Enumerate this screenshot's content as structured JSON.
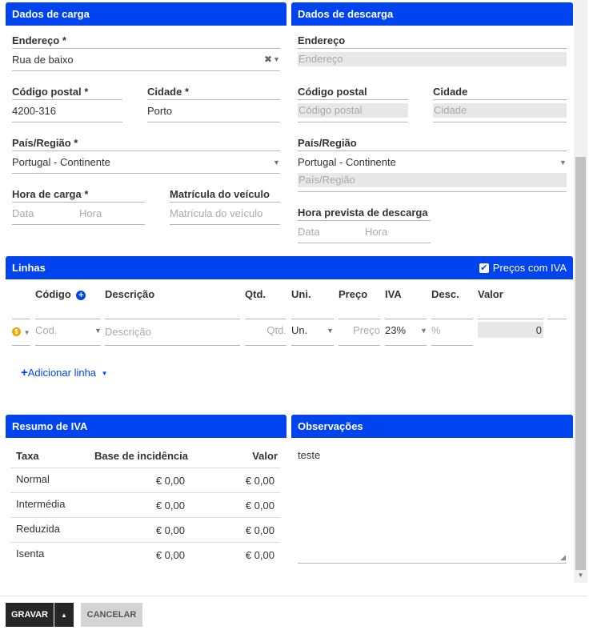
{
  "loading": {
    "title": "Dados de carga",
    "address_label": "Endereço *",
    "address_value": "Rua de baixo",
    "postal_label": "Código postal *",
    "postal_value": "4200-316",
    "city_label": "Cidade *",
    "city_value": "Porto",
    "country_label": "País/Região *",
    "country_value": "Portugal - Continente",
    "time_label": "Hora de carga *",
    "date_placeholder": "Data",
    "hour_placeholder": "Hora",
    "plate_label": "Matrícula do veículo",
    "plate_placeholder": "Matrícula do veículo"
  },
  "unloading": {
    "title": "Dados de descarga",
    "address_label": "Endereço",
    "address_placeholder": "Endereço",
    "postal_label": "Código postal",
    "postal_placeholder": "Código postal",
    "city_label": "Cidade",
    "city_placeholder": "Cidade",
    "country_label": "País/Região",
    "country_value": "Portugal - Continente",
    "country_placeholder": "País/Região",
    "time_label": "Hora prevista de descarga",
    "date_placeholder": "Data",
    "hour_placeholder": "Hora"
  },
  "lines": {
    "title": "Linhas",
    "prices_with_vat_label": "Preços com IVA",
    "prices_with_vat_checked": true,
    "columns": {
      "code": "Código",
      "description": "Descrição",
      "qty": "Qtd.",
      "unit": "Uni.",
      "price": "Preço",
      "vat": "IVA",
      "discount": "Desc.",
      "value": "Valor"
    },
    "row": {
      "code_placeholder": "Cod.",
      "description_placeholder": "Descrição",
      "qty_placeholder": "Qtd.",
      "unit_value": "Un.",
      "price_placeholder": "Preço",
      "vat_value": "23%",
      "discount_placeholder": "%",
      "value": "0"
    },
    "add_line_label": "Adicionar linha"
  },
  "vat_summary": {
    "title": "Resumo de IVA",
    "headers": [
      "Taxa",
      "Base de incidência",
      "Valor"
    ],
    "rows": [
      {
        "rate": "Normal",
        "base": "€ 0,00",
        "value": "€ 0,00"
      },
      {
        "rate": "Intermédia",
        "base": "€ 0,00",
        "value": "€ 0,00"
      },
      {
        "rate": "Reduzida",
        "base": "€ 0,00",
        "value": "€ 0,00"
      },
      {
        "rate": "Isenta",
        "base": "€ 0,00",
        "value": "€ 0,00"
      }
    ]
  },
  "notes": {
    "title": "Observações",
    "value": "teste"
  },
  "footer": {
    "save_label": "GRAVAR",
    "cancel_label": "CANCELAR"
  },
  "colors": {
    "panel_header": "#0044f0",
    "link": "#0044f0",
    "save_button": "#262626",
    "row_status": "#f0a500"
  }
}
